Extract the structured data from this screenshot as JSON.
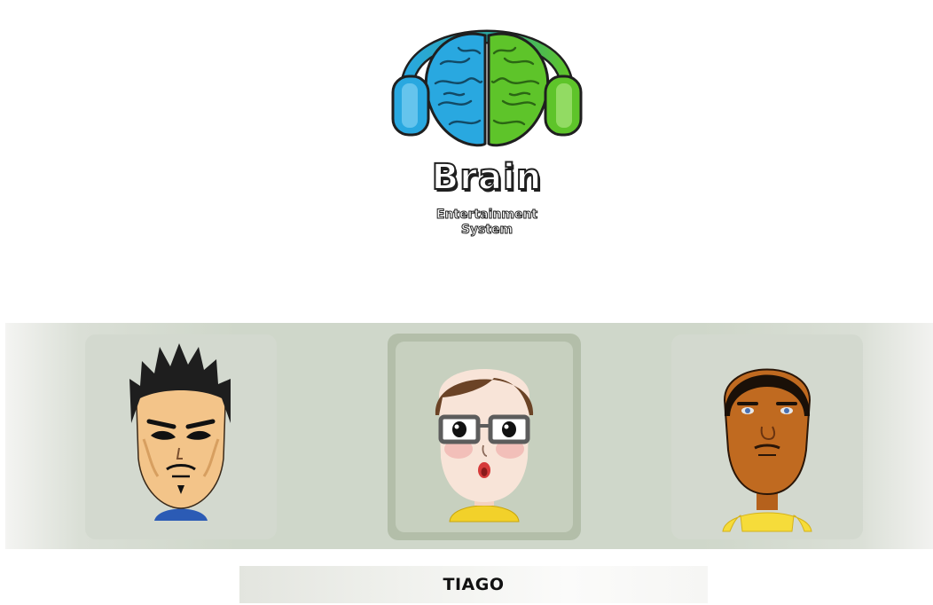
{
  "logo": {
    "title": "Brain",
    "subtitle_line1": "Entertainment",
    "subtitle_line2": "System",
    "left_color": "#29a8e0",
    "right_color": "#5ec42a"
  },
  "avatars": [
    {
      "position": "left",
      "name": "",
      "icon": "spiky-hair-mii-avatar"
    },
    {
      "position": "center",
      "name": "TIAGO",
      "icon": "glasses-mii-avatar",
      "selected": true
    },
    {
      "position": "right",
      "name": "",
      "icon": "bald-mii-avatar"
    }
  ],
  "selected_name": "TIAGO",
  "colors": {
    "carousel_bg": "#cfd7ca",
    "card_bg": "#d3d9cf",
    "selected_card_bg": "#b3bea9"
  }
}
